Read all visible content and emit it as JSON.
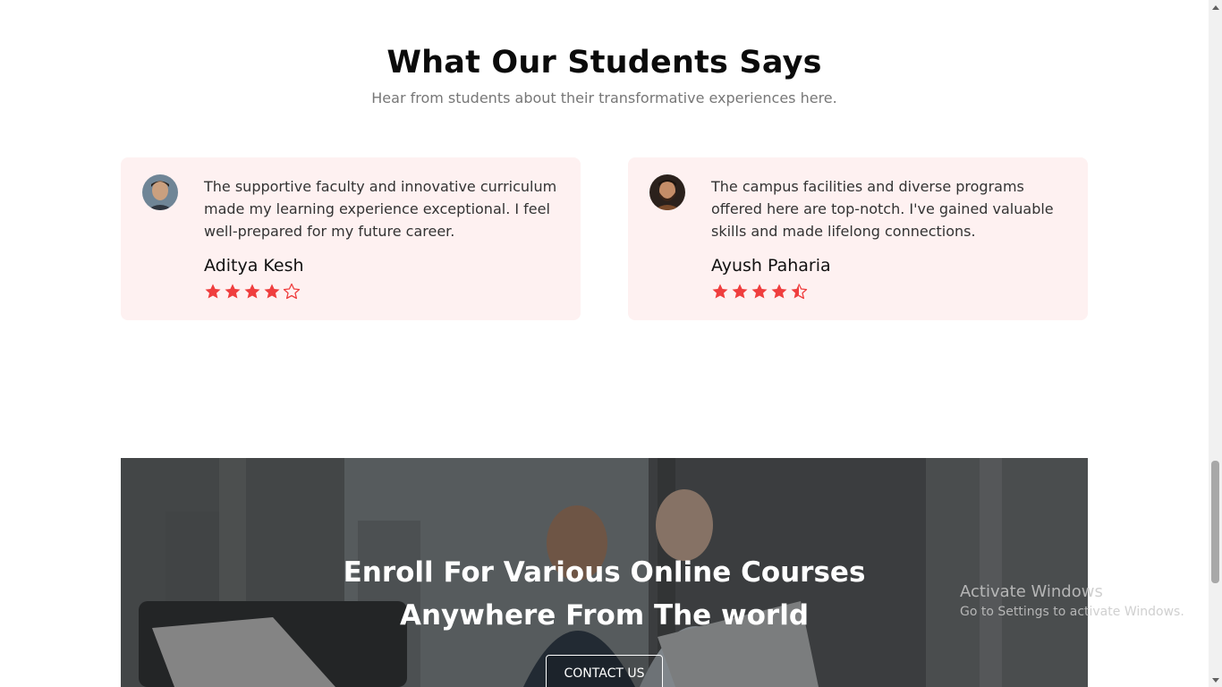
{
  "testimonials": {
    "title": "What Our Students Says",
    "subtitle": "Hear from students about their transformative experiences here.",
    "items": [
      {
        "quote": "The supportive faculty and innovative curriculum made my learning experience exceptional. I feel well-prepared for my future career.",
        "name": "Aditya Kesh",
        "rating": 4,
        "rating_max": 5
      },
      {
        "quote": "The campus facilities and diverse programs offered here are top-notch. I've gained valuable skills and made lifelong connections.",
        "name": "Ayush Paharia",
        "rating": 4.5,
        "rating_max": 5
      }
    ]
  },
  "banner": {
    "title_line1": "Enroll For Various Online Courses",
    "title_line2": "Anywhere From The world",
    "button_label": "CONTACT US"
  },
  "watermark": {
    "line1": "Activate Windows",
    "line2": "Go to Settings to activate Windows."
  },
  "colors": {
    "card_bg": "#fef1f1",
    "star": "#ef3e3e"
  },
  "icons": {
    "star_full": "star-icon",
    "star_half": "star-half-icon",
    "star_empty": "star-outline-icon"
  }
}
